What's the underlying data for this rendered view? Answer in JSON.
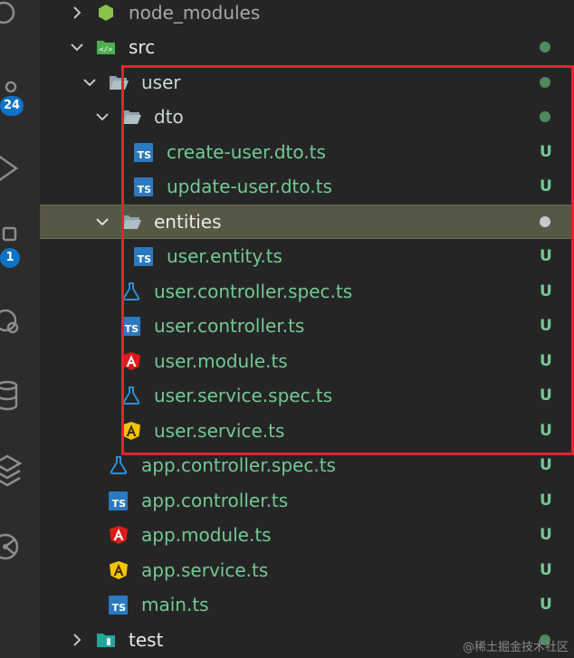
{
  "activity_bar": {
    "badges": [
      "24",
      "1"
    ]
  },
  "colors": {
    "tracked_green": "#73c991",
    "ts_blue": "#2b79c0",
    "angular_red": "#dd1b16",
    "angular_yellow": "#f5c400",
    "highlight_red": "#e3232d"
  },
  "tree": [
    {
      "label": "node_modules",
      "kind": "folder-node",
      "chevron": "right",
      "status": "",
      "icon": "node-folder-icon"
    },
    {
      "label": "src",
      "kind": "folder-src",
      "chevron": "down",
      "status": "",
      "icon": "src-folder-icon"
    },
    {
      "label": "user",
      "kind": "folder",
      "chevron": "down",
      "status": "",
      "icon": "folder-open-icon"
    },
    {
      "label": "dto",
      "kind": "folder",
      "chevron": "down",
      "status": "",
      "icon": "folder-open-icon"
    },
    {
      "label": "create-user.dto.ts",
      "kind": "ts",
      "status": "U",
      "icon": "typescript-icon"
    },
    {
      "label": "update-user.dto.ts",
      "kind": "ts",
      "status": "U",
      "icon": "typescript-icon"
    },
    {
      "label": "entities",
      "kind": "folder",
      "chevron": "down",
      "status": "",
      "icon": "folder-open-icon",
      "selected": true
    },
    {
      "label": "user.entity.ts",
      "kind": "ts",
      "status": "U",
      "icon": "typescript-icon"
    },
    {
      "label": "user.controller.spec.ts",
      "kind": "spec",
      "status": "U",
      "icon": "test-flask-icon"
    },
    {
      "label": "user.controller.ts",
      "kind": "ts",
      "status": "U",
      "icon": "typescript-icon"
    },
    {
      "label": "user.module.ts",
      "kind": "angular-red",
      "status": "U",
      "icon": "angular-module-icon"
    },
    {
      "label": "user.service.spec.ts",
      "kind": "spec",
      "status": "U",
      "icon": "test-flask-icon"
    },
    {
      "label": "user.service.ts",
      "kind": "angular-yellow",
      "status": "U",
      "icon": "angular-service-icon"
    },
    {
      "label": "app.controller.spec.ts",
      "kind": "spec",
      "status": "U",
      "icon": "test-flask-icon"
    },
    {
      "label": "app.controller.ts",
      "kind": "ts",
      "status": "U",
      "icon": "typescript-icon"
    },
    {
      "label": "app.module.ts",
      "kind": "angular-red",
      "status": "U",
      "icon": "angular-module-icon"
    },
    {
      "label": "app.service.ts",
      "kind": "angular-yellow",
      "status": "U",
      "icon": "angular-service-icon"
    },
    {
      "label": "main.ts",
      "kind": "ts",
      "status": "U",
      "icon": "typescript-icon"
    },
    {
      "label": "test",
      "kind": "folder-test",
      "chevron": "right",
      "status": "",
      "icon": "test-folder-icon"
    }
  ],
  "ts_icon_text": "TS",
  "watermark": "@稀土掘金技术社区"
}
